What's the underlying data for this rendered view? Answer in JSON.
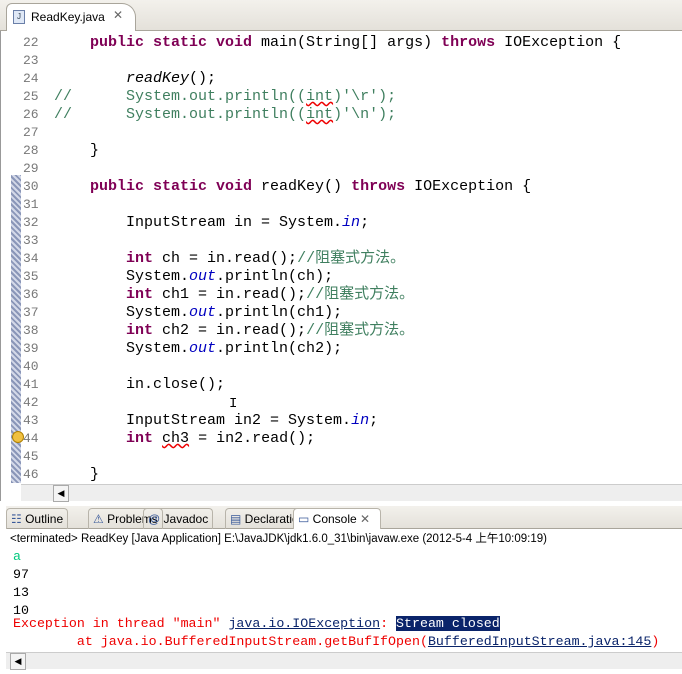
{
  "editor": {
    "tab_label": "ReadKey.java",
    "lines": [
      {
        "n": "22",
        "parts": [
          [
            "",
            "    "
          ],
          [
            "kw",
            "public static void"
          ],
          [
            "",
            " main(String[] args) "
          ],
          [
            "kw",
            "throws"
          ],
          [
            "",
            " IOException {"
          ]
        ]
      },
      {
        "n": "23",
        "parts": []
      },
      {
        "n": "24",
        "parts": [
          [
            "",
            "        "
          ],
          [
            "it",
            "readKey"
          ],
          [
            "",
            "();"
          ]
        ]
      },
      {
        "n": "25",
        "parts": [
          [
            "cm",
            "//      System.out.println(("
          ],
          [
            "cm sq",
            "int"
          ],
          [
            "cm",
            ")'\\r');"
          ]
        ]
      },
      {
        "n": "26",
        "parts": [
          [
            "cm",
            "//      System.out.println(("
          ],
          [
            "cm sq",
            "int"
          ],
          [
            "cm",
            ")'\\n');"
          ]
        ]
      },
      {
        "n": "27",
        "parts": []
      },
      {
        "n": "28",
        "parts": [
          [
            "",
            "    }"
          ]
        ]
      },
      {
        "n": "29",
        "parts": []
      },
      {
        "n": "30",
        "parts": [
          [
            "",
            "    "
          ],
          [
            "kw",
            "public static void"
          ],
          [
            "",
            " readKey() "
          ],
          [
            "kw",
            "throws"
          ],
          [
            "",
            " IOException {"
          ]
        ]
      },
      {
        "n": "31",
        "parts": []
      },
      {
        "n": "32",
        "parts": [
          [
            "",
            "        InputStream in = System."
          ],
          [
            "fi",
            "in"
          ],
          [
            "",
            ";"
          ]
        ]
      },
      {
        "n": "33",
        "parts": []
      },
      {
        "n": "34",
        "parts": [
          [
            "",
            "        "
          ],
          [
            "kw",
            "int"
          ],
          [
            "",
            " ch = in.read();"
          ],
          [
            "cm",
            "//阻塞式方法。"
          ]
        ]
      },
      {
        "n": "35",
        "parts": [
          [
            "",
            "        System."
          ],
          [
            "fi",
            "out"
          ],
          [
            "",
            ".println(ch);"
          ]
        ]
      },
      {
        "n": "36",
        "parts": [
          [
            "",
            "        "
          ],
          [
            "kw",
            "int"
          ],
          [
            "",
            " ch1 = in.read();"
          ],
          [
            "cm",
            "//阻塞式方法。"
          ]
        ]
      },
      {
        "n": "37",
        "parts": [
          [
            "",
            "        System."
          ],
          [
            "fi",
            "out"
          ],
          [
            "",
            ".println(ch1);"
          ]
        ]
      },
      {
        "n": "38",
        "parts": [
          [
            "",
            "        "
          ],
          [
            "kw",
            "int"
          ],
          [
            "",
            " ch2 = in.read();"
          ],
          [
            "cm",
            "//阻塞式方法。"
          ]
        ]
      },
      {
        "n": "39",
        "parts": [
          [
            "",
            "        System."
          ],
          [
            "fi",
            "out"
          ],
          [
            "",
            ".println(ch2);"
          ]
        ]
      },
      {
        "n": "40",
        "parts": []
      },
      {
        "n": "41",
        "parts": [
          [
            "",
            "        in.close();"
          ]
        ]
      },
      {
        "n": "42",
        "parts": []
      },
      {
        "n": "43",
        "parts": [
          [
            "",
            "        InputStream in2 = System."
          ],
          [
            "fi",
            "in"
          ],
          [
            "",
            ";"
          ]
        ]
      },
      {
        "n": "44",
        "parts": [
          [
            "",
            "        "
          ],
          [
            "kw",
            "int"
          ],
          [
            "",
            " "
          ],
          [
            "sq",
            "ch3"
          ],
          [
            "",
            " = in2.read();"
          ]
        ]
      },
      {
        "n": "45",
        "parts": []
      },
      {
        "n": "46",
        "parts": [
          [
            "",
            "    }"
          ]
        ]
      }
    ]
  },
  "views": {
    "tabs": [
      "Outline",
      "Problems",
      "Javadoc",
      "Declaration",
      "Console"
    ],
    "active": "Console"
  },
  "console": {
    "status": "<terminated> ReadKey [Java Application] E:\\JavaJDK\\jdk1.6.0_31\\bin\\javaw.exe (2012-5-4 上午10:09:19)",
    "input_line": "a",
    "output": [
      "97",
      "13",
      "10"
    ],
    "exception_prefix": "Exception in thread \"main\" ",
    "exception_class": "java.io.IOException",
    "exception_colon": ": ",
    "exception_message": "Stream closed",
    "trace_prefix": "\tat java.io.BufferedInputStream.getBufIfOpen(",
    "trace_link": "BufferedInputStream.java:145",
    "trace_suffix": ")",
    "colors": {
      "input": "#00c87d",
      "error": "#ff0000",
      "highlight": "#0a246a"
    }
  }
}
